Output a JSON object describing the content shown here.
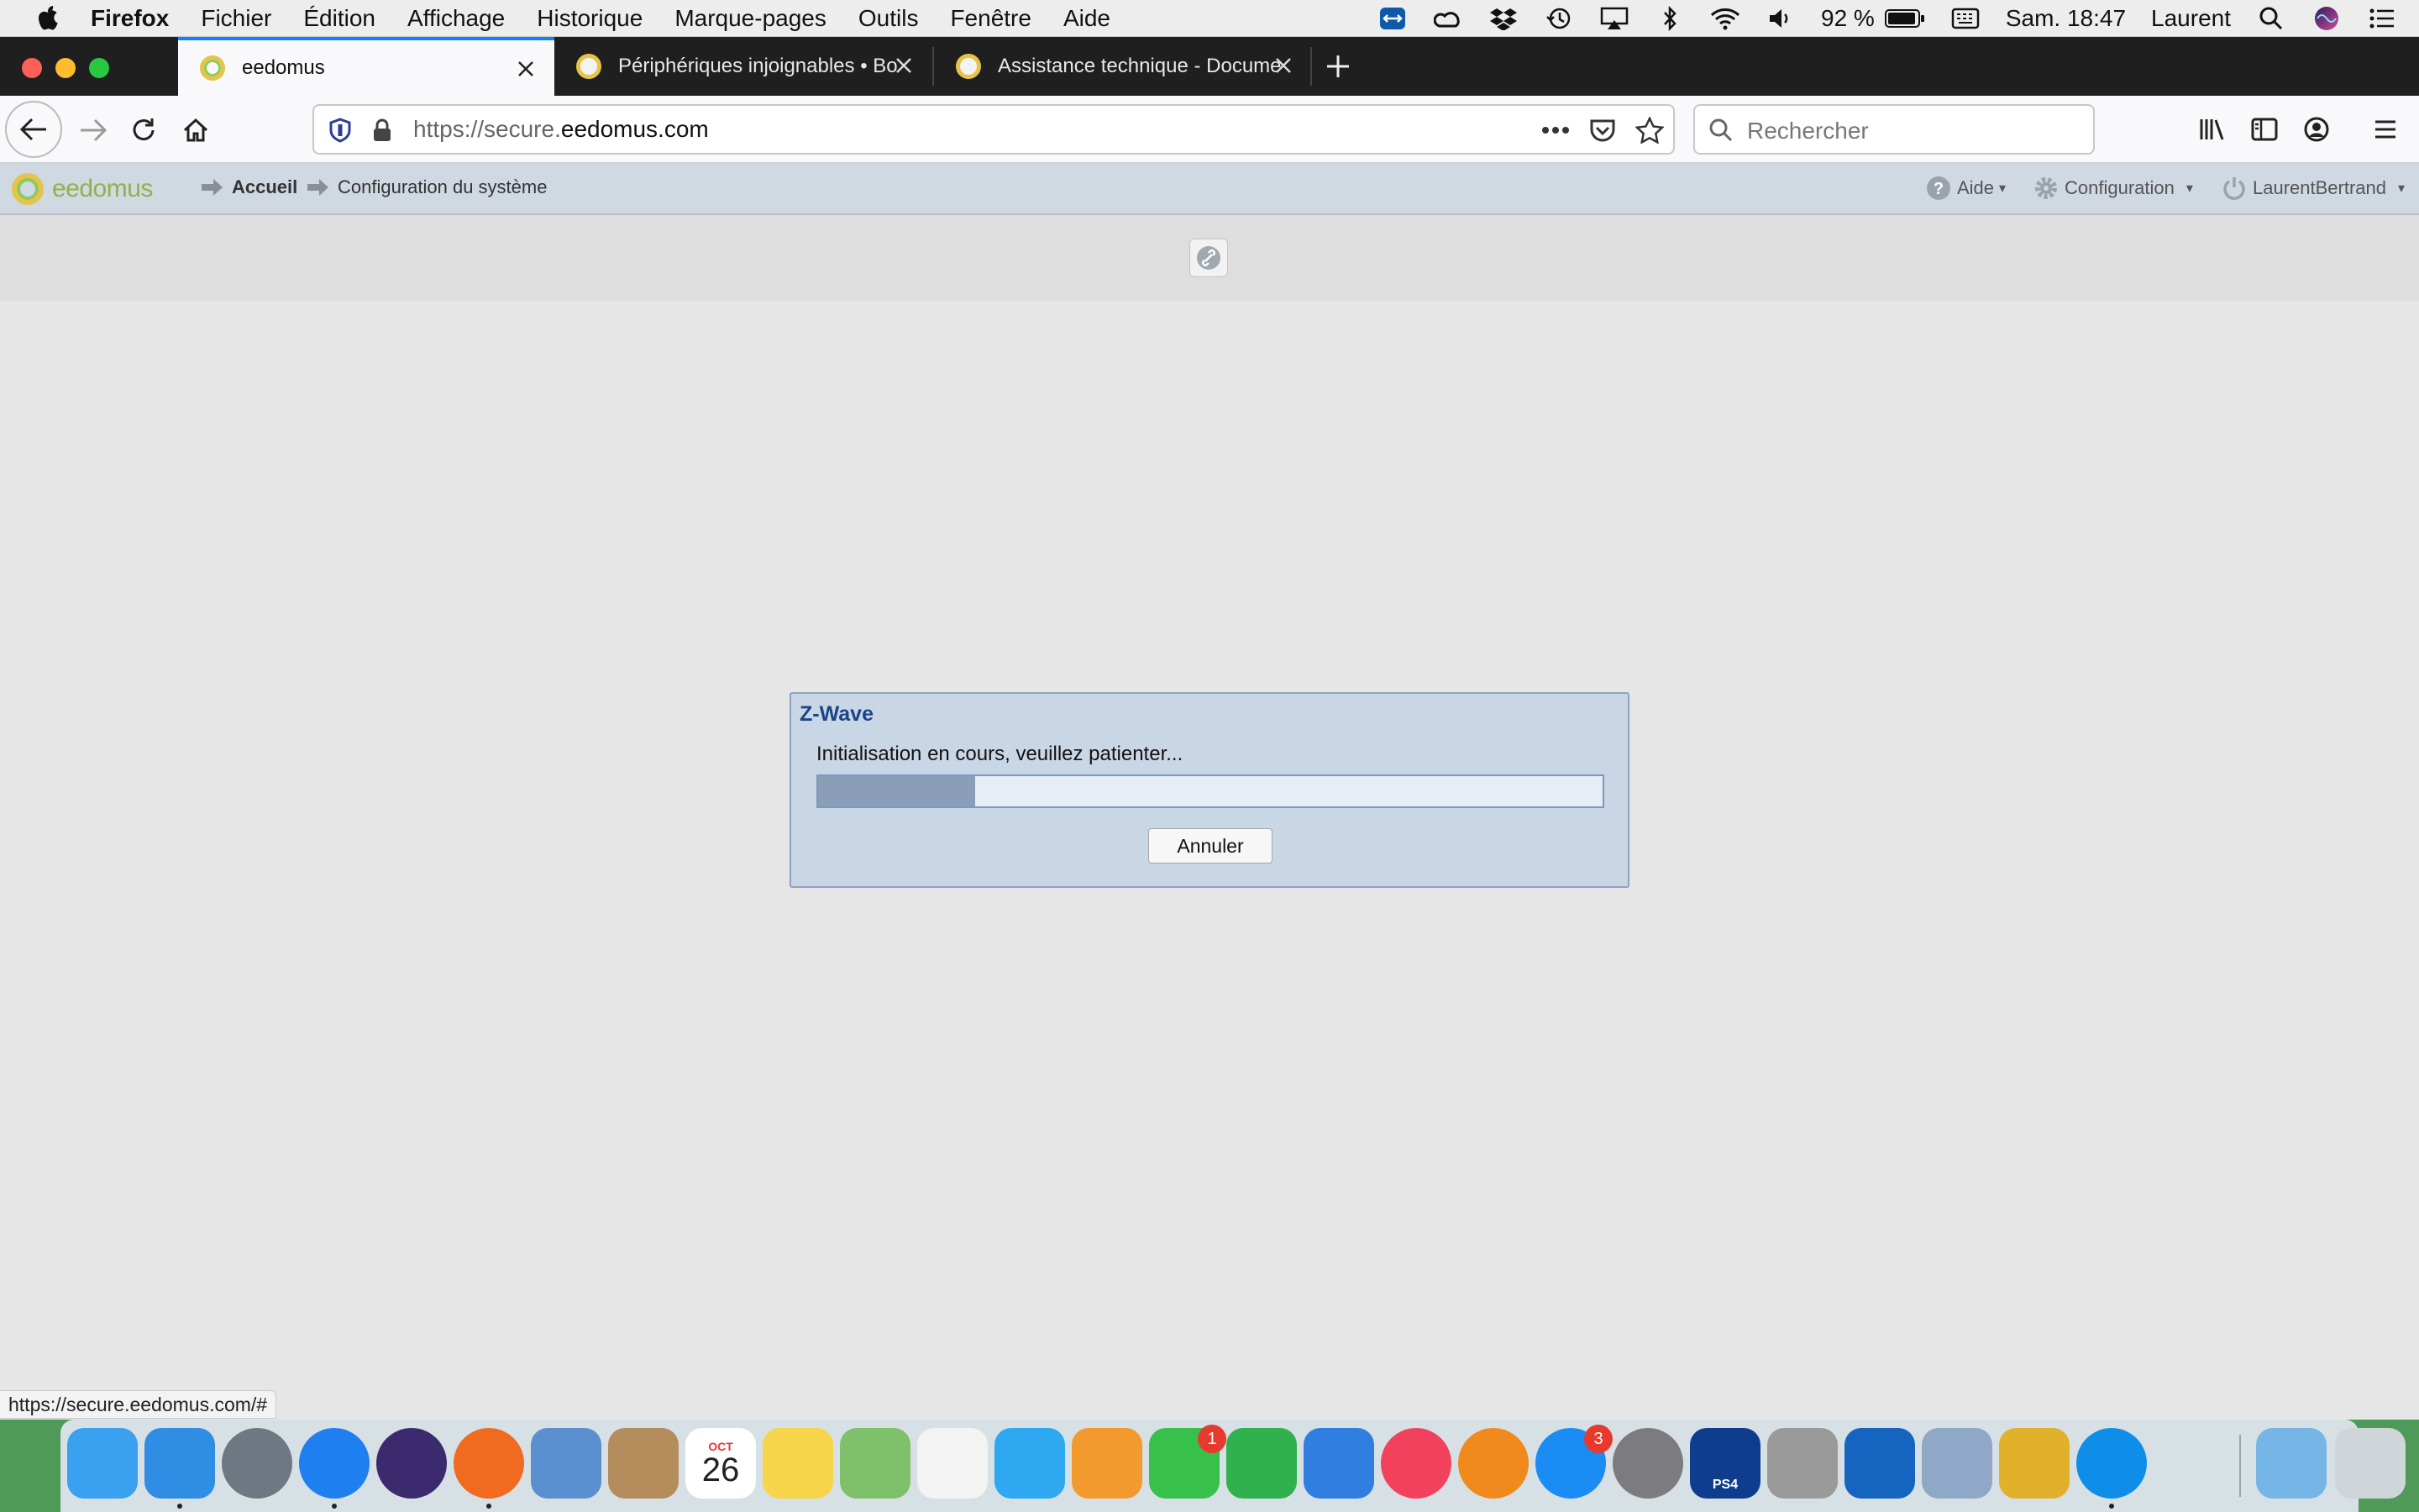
{
  "menubar": {
    "app_name": "Firefox",
    "items": [
      "Fichier",
      "Édition",
      "Affichage",
      "Historique",
      "Marque-pages",
      "Outils",
      "Fenêtre",
      "Aide"
    ],
    "battery": "92 %",
    "clock": "Sam. 18:47",
    "user": "Laurent",
    "status_icons": [
      "teamviewer-icon",
      "creative-cloud-icon",
      "dropbox-icon",
      "time-machine-icon",
      "airplay-icon",
      "bluetooth-icon",
      "wifi-icon",
      "volume-icon",
      "battery-icon",
      "keyboard-icon",
      "spotlight-icon",
      "siri-icon",
      "notification-center-icon"
    ]
  },
  "tabs": [
    {
      "title": "eedomus",
      "active": true
    },
    {
      "title": "Périphériques injoignables • Bo",
      "active": false
    },
    {
      "title": "Assistance technique - Docume",
      "active": false
    }
  ],
  "navbar": {
    "url_prefix": "https://secure.",
    "url_domain": "eedomus.com",
    "search_placeholder": "Rechercher"
  },
  "app_header": {
    "logo_text": "eedomus",
    "breadcrumb_home": "Accueil",
    "breadcrumb_current": "Configuration du système",
    "help_label": "Aide",
    "config_label": "Configuration",
    "user_label": "LaurentBertrand"
  },
  "dialog": {
    "title": "Z-Wave",
    "message": "Initialisation en cours, veuillez patienter...",
    "progress": 0.2,
    "cancel_label": "Annuler"
  },
  "status_link": "https://secure.eedomus.com/#",
  "dock": {
    "apps": [
      {
        "name": "messages-app-icon",
        "color": "#3aa0f0"
      },
      {
        "name": "finder-icon",
        "color": "#2f8de4",
        "running": true
      },
      {
        "name": "launchpad-icon",
        "color": "#6f7782"
      },
      {
        "name": "safari-icon",
        "color": "#1d7ff0",
        "running": true
      },
      {
        "name": "siri-app-icon",
        "color": "#3c2a6e"
      },
      {
        "name": "firefox-icon",
        "color": "#f06a1f",
        "running": true
      },
      {
        "name": "mail-icon",
        "color": "#5b8fcf"
      },
      {
        "name": "contacts-icon",
        "color": "#b58c5c"
      },
      {
        "name": "calendar-icon",
        "color": "#ffffff"
      },
      {
        "name": "notes-icon",
        "color": "#f6d54a"
      },
      {
        "name": "maps-icon",
        "color": "#7fc06a"
      },
      {
        "name": "photos-icon",
        "color": "#f3f3f3"
      },
      {
        "name": "messages-icon",
        "color": "#2ea8f0"
      },
      {
        "name": "pages-icon",
        "color": "#f29a2e"
      },
      {
        "name": "facetime-icon",
        "color": "#37c14b",
        "badge": "1"
      },
      {
        "name": "numbers-icon",
        "color": "#2fb24e"
      },
      {
        "name": "keynote-icon",
        "color": "#2f7ee0"
      },
      {
        "name": "music-icon",
        "color": "#f2415d"
      },
      {
        "name": "books-icon",
        "color": "#f08a1c"
      },
      {
        "name": "app-store-icon",
        "color": "#1a8cf3",
        "badge": "3"
      },
      {
        "name": "system-preferences-icon",
        "color": "#7c7c80"
      },
      {
        "name": "ps4-remote-play-icon",
        "color": "#0d3d8c"
      },
      {
        "name": "utility-app-icon",
        "color": "#9a9a9a"
      },
      {
        "name": "outlook-icon",
        "color": "#1565c0"
      },
      {
        "name": "preview-icon",
        "color": "#8fa8c8"
      },
      {
        "name": "database-icon",
        "color": "#e1b12c"
      },
      {
        "name": "teamviewer-dock-icon",
        "color": "#0e8ee9",
        "running": true
      },
      {
        "name": "downloads-folder-icon",
        "color": "#75b6e6"
      },
      {
        "name": "trash-icon",
        "color": "#cfd6da"
      }
    ],
    "calendar_month": "OCT",
    "calendar_day": "26",
    "ps4_label": "PS4"
  }
}
